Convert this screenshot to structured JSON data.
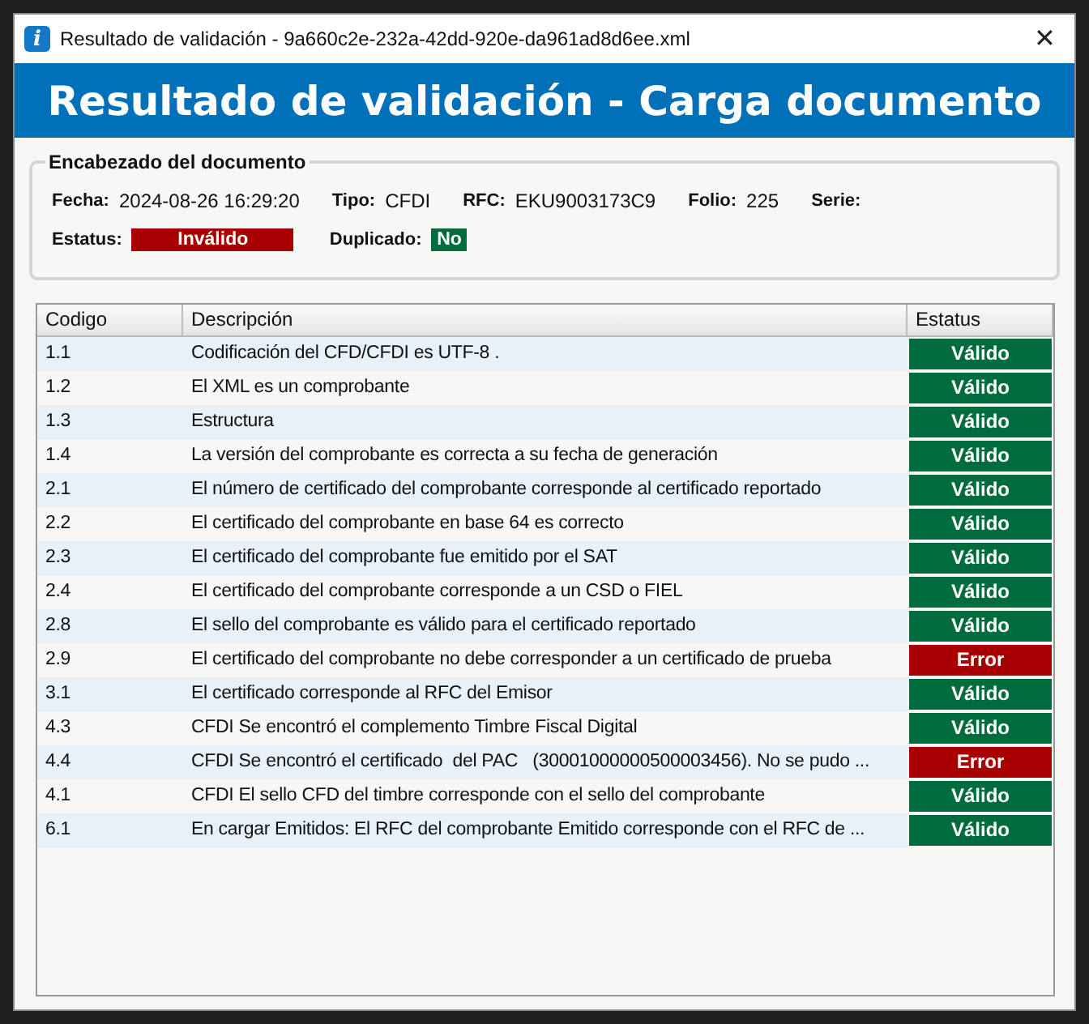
{
  "window": {
    "title": "Resultado de validación - 9a660c2e-232a-42dd-920e-da961ad8d6ee.xml",
    "close": "✕",
    "app_icon": "i"
  },
  "banner": "Resultado de validación - Carga documento",
  "header_group": {
    "title": "Encabezado del documento",
    "fields": [
      {
        "label": "Fecha:",
        "value": "2024-08-26 16:29:20"
      },
      {
        "label": "Tipo:",
        "value": "CFDI"
      },
      {
        "label": "RFC:",
        "value": "EKU9003173C9"
      },
      {
        "label": "Folio:",
        "value": "225"
      },
      {
        "label": "Serie:"
      }
    ],
    "status": {
      "label": "Estatus:",
      "value": "Inválido",
      "kind": "error"
    },
    "duplicate": {
      "label": "Duplicado:",
      "value": "No",
      "kind": "valid"
    }
  },
  "table": {
    "columns": [
      "Codigo",
      "Descripción",
      "Estatus"
    ],
    "rows": [
      {
        "code": "1.1",
        "description": "Codificación del CFD/CFDI es UTF-8 .",
        "status": "Válido",
        "kind": "valid"
      },
      {
        "code": "1.2",
        "description": "El XML es un comprobante",
        "status": "Válido",
        "kind": "valid"
      },
      {
        "code": "1.3",
        "description": "Estructura",
        "status": "Válido",
        "kind": "valid"
      },
      {
        "code": "1.4",
        "description": "La versión del comprobante es correcta a su fecha de generación",
        "status": "Válido",
        "kind": "valid"
      },
      {
        "code": "2.1",
        "description": "El número de certificado del comprobante corresponde al certificado reportado",
        "status": "Válido",
        "kind": "valid"
      },
      {
        "code": "2.2",
        "description": "El certificado del comprobante en base 64 es correcto",
        "status": "Válido",
        "kind": "valid"
      },
      {
        "code": "2.3",
        "description": "El certificado del comprobante fue emitido por el SAT",
        "status": "Válido",
        "kind": "valid"
      },
      {
        "code": "2.4",
        "description": "El certificado del comprobante corresponde a un CSD o FIEL",
        "status": "Válido",
        "kind": "valid"
      },
      {
        "code": "2.8",
        "description": "El sello del comprobante es válido para el certificado reportado",
        "status": "Válido",
        "kind": "valid"
      },
      {
        "code": "2.9",
        "description": "El certificado del comprobante no debe corresponder a un certificado de prueba",
        "status": "Error",
        "kind": "error"
      },
      {
        "code": "3.1",
        "description": "El certificado corresponde al RFC del Emisor",
        "status": "Válido",
        "kind": "valid"
      },
      {
        "code": "4.3",
        "description": "CFDI Se encontró el complemento Timbre Fiscal Digital",
        "status": "Válido",
        "kind": "valid"
      },
      {
        "code": "4.4",
        "description": "CFDI Se encontró el certificado  del PAC   (30001000000500003456). No se pudo ...",
        "status": "Error",
        "kind": "error"
      },
      {
        "code": "4.1",
        "description": "CFDI El sello CFD del timbre corresponde con el sello del comprobante",
        "status": "Válido",
        "kind": "valid"
      },
      {
        "code": "6.1",
        "description": "En cargar Emitidos: El RFC del comprobante Emitido corresponde con el RFC de ...",
        "status": "Válido",
        "kind": "valid"
      }
    ]
  }
}
